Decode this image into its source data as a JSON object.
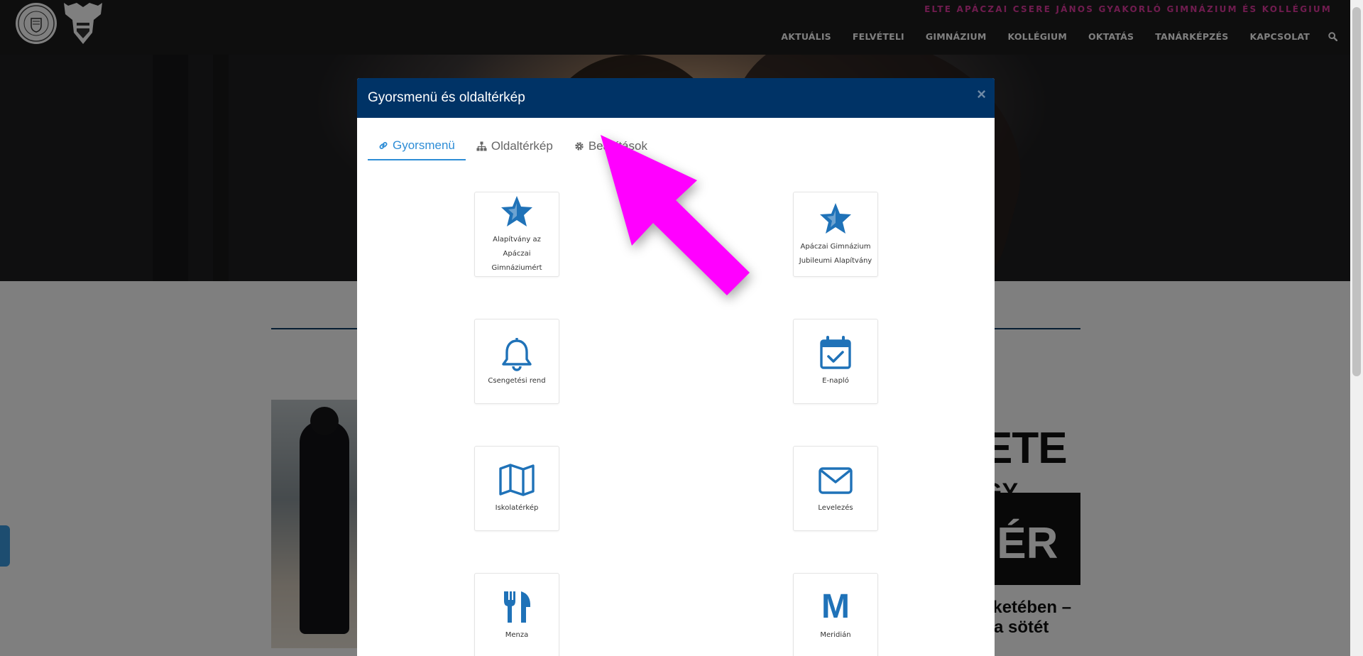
{
  "site": {
    "school_name": "ELTE APÁCZAI CSERE JÁNOS GYAKORLÓ GIMNÁZIUM ÉS KOLLÉGIUM",
    "nav": [
      {
        "label": "AKTUÁLIS"
      },
      {
        "label": "FELVÉTELI"
      },
      {
        "label": "GIMNÁZIUM"
      },
      {
        "label": "KOLLÉGIUM"
      },
      {
        "label": "OKTATÁS"
      },
      {
        "label": "TANÁRKÉPZÉS"
      },
      {
        "label": "KAPCSOLAT"
      }
    ],
    "search_icon": "search-icon"
  },
  "background": {
    "feature_title": "ETE",
    "feature_sub": "GY",
    "feature_box": "IÉR",
    "feature_text1": "eketében –",
    "feature_text2": "a sötét"
  },
  "modal": {
    "title": "Gyorsmenü és oldaltérkép",
    "close": "×",
    "tabs": [
      {
        "label": "Gyorsmenü",
        "icon": "link-icon",
        "active": true
      },
      {
        "label": "Oldaltérkép",
        "icon": "sitemap-icon",
        "active": false
      },
      {
        "label": "Beállítások",
        "icon": "gear-icon",
        "active": false
      }
    ],
    "tiles": [
      {
        "label": "Alapítvány az Apáczai Gimnáziumért",
        "icon": "star-icon"
      },
      {
        "label": "Apáczai Gimnázium Jubileumi Alapítvány",
        "icon": "star-icon"
      },
      {
        "label": "Csengetési rend",
        "icon": "bell-icon"
      },
      {
        "label": "E-napló",
        "icon": "calendar-check-icon"
      },
      {
        "label": "Iskolatérkép",
        "icon": "map-icon"
      },
      {
        "label": "Levelezés",
        "icon": "envelope-icon"
      },
      {
        "label": "Menza",
        "icon": "cutlery-icon"
      },
      {
        "label": "Meridián",
        "icon": "meridian-m-icon",
        "glyph": "M"
      }
    ]
  },
  "colors": {
    "accent": "#2e8dd6",
    "icon_blue": "#1f72b8",
    "modal_header": "#003366",
    "school_name": "#e0389e",
    "annotation": "#ff00ff"
  }
}
